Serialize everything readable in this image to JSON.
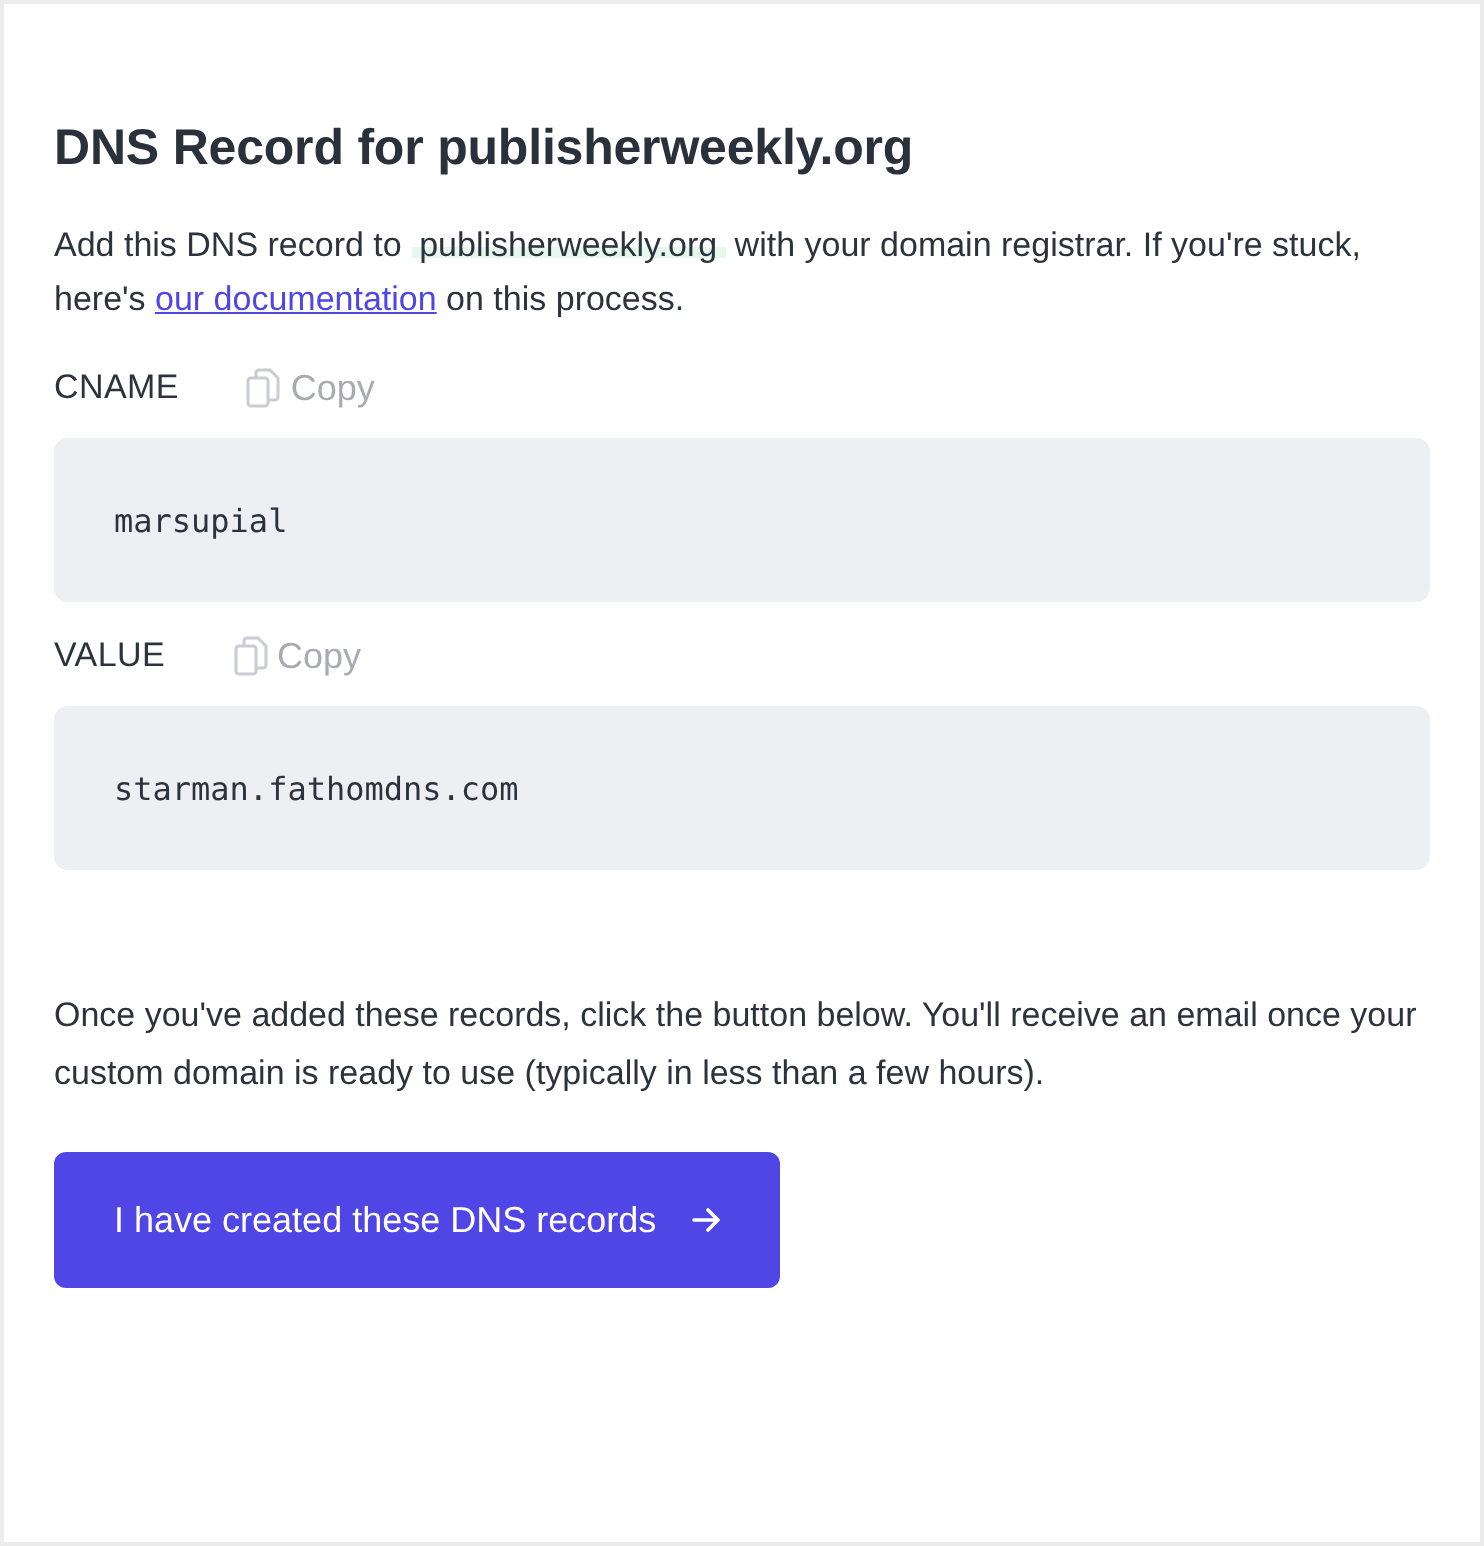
{
  "title": "DNS Record for publisherweekly.org",
  "intro": {
    "before": "Add this DNS record to ",
    "domain": "publisherweekly.org",
    "middle": " with your domain registrar. If you're stuck, here's ",
    "link": "our documentation",
    "after": " on this process."
  },
  "records": [
    {
      "label": "CNAME",
      "copy": "Copy",
      "value": "marsupial"
    },
    {
      "label": "VALUE",
      "copy": "Copy",
      "value": "starman.fathomdns.com"
    }
  ],
  "note": "Once you've added these records, click the button below. You'll receive an email once your custom domain is ready to use (typically in less than a few hours).",
  "button": "I have created these DNS records"
}
